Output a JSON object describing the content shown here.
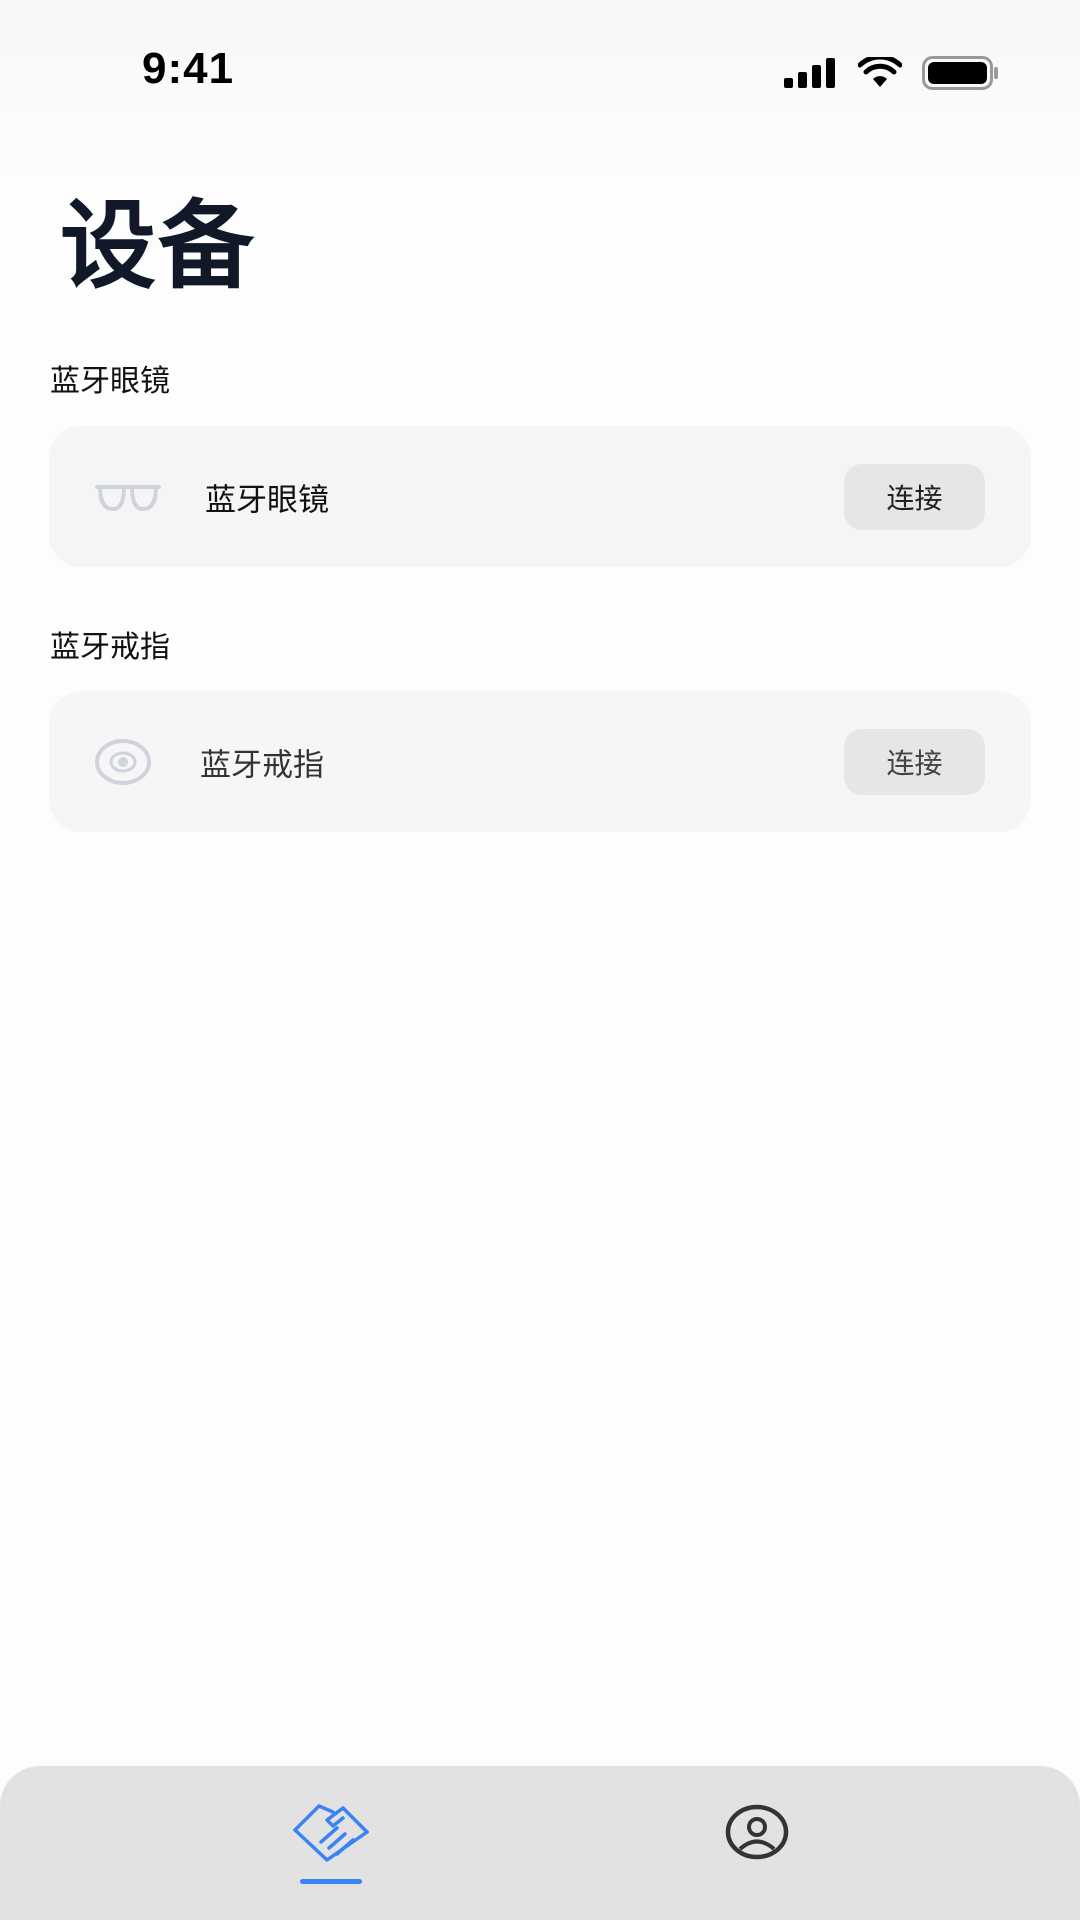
{
  "status_bar": {
    "time": "9:41",
    "icons": [
      "cellular-signal-icon",
      "wifi-icon",
      "battery-icon"
    ]
  },
  "page": {
    "title": "设备"
  },
  "sections": [
    {
      "label": "蓝牙眼镜",
      "device": {
        "icon": "glasses-icon",
        "name": "蓝牙眼镜",
        "action_label": "连接"
      }
    },
    {
      "label": "蓝牙戒指",
      "device": {
        "icon": "ring-icon",
        "name": "蓝牙戒指",
        "action_label": "连接"
      }
    }
  ],
  "tab_bar": {
    "tabs": [
      {
        "icon": "handshake-icon",
        "active": true
      },
      {
        "icon": "user-circle-icon",
        "active": false
      }
    ]
  },
  "colors": {
    "accent": "#3b82f6",
    "card_background": "#f5f5f5",
    "tab_bar_background": "#e2e2e2",
    "icon_muted": "#cfd3dc"
  }
}
